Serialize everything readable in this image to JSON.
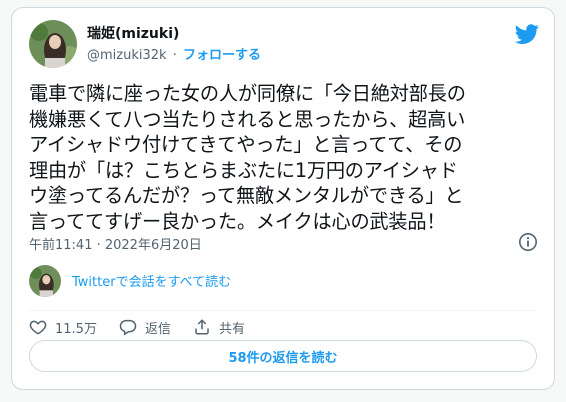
{
  "user": {
    "display_name": "瑞姫(mizuki)",
    "handle": "@mizuki32k",
    "separator": "·",
    "follow_label": "フォローする"
  },
  "tweet": {
    "lines": [
      "電車で隣に座った女の人が同僚に「今日絶対部長の",
      "機嫌悪くて八つ当たりされると思ったから、超高い",
      "アイシャドウ付けてきてやった」と言ってて、その",
      "理由が「は？こちとらまぶたに1万円のアイシャド",
      "ウ塗ってるんだが？って無敵メンタルができる」と",
      "言っててすげー良かった。メイクは心の武装品！"
    ],
    "timestamp": "午前11:41 · 2022年6月20日"
  },
  "conversation_link": "Twitterで会話をすべて読む",
  "actions": {
    "like_count": "11.5万",
    "reply_label": "返信",
    "share_label": "共有"
  },
  "read_replies_label": "58件の返信を読む",
  "icons": {
    "brand": "twitter-bird-icon",
    "info": "info-icon",
    "like": "heart-icon",
    "reply": "reply-bubble-icon",
    "share": "share-icon"
  },
  "colors": {
    "accent": "#1d9bf0",
    "text": "#0f1419",
    "secondary": "#536471",
    "border": "#cfd9de"
  }
}
